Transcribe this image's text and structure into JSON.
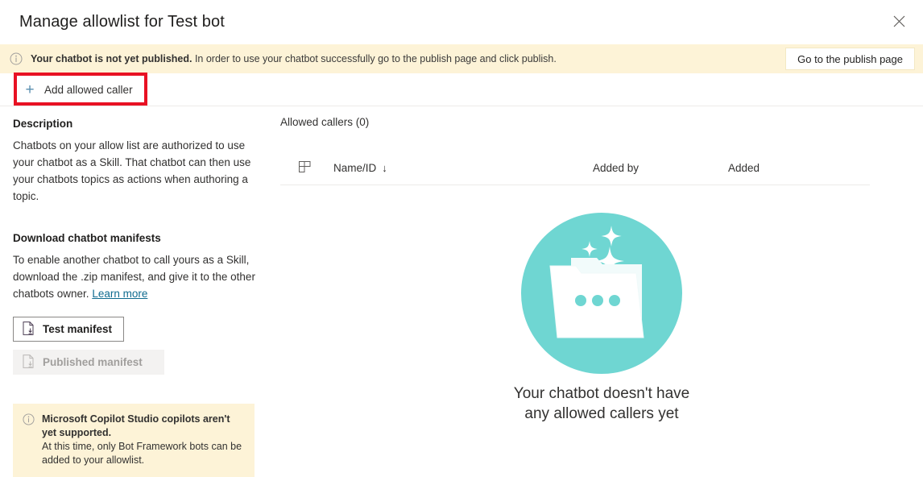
{
  "dialog": {
    "title": "Manage allowlist for Test bot",
    "close_icon": "close-icon"
  },
  "banner": {
    "info_icon": "info-circle-icon",
    "bold_text": "Your chatbot is not yet published.",
    "rest_text": " In order to use your chatbot successfully go to the publish page and click publish.",
    "action_label": "Go to the publish page",
    "background_color": "#fdf3d7"
  },
  "commandbar": {
    "add_caller_label": "Add allowed caller",
    "add_icon": "plus-icon",
    "highlight_color": "#e81123"
  },
  "left_pane": {
    "description_heading": "Description",
    "description_text": "Chatbots on your allow list are authorized to use your chatbot as a Skill. That chatbot can then use your chatbots topics as actions when authoring a topic.",
    "download_heading": "Download chatbot manifests",
    "download_text": "To enable another chatbot to call yours as a Skill, download the .zip manifest, and give it to the other chatbots owner. ",
    "learn_more_label": "Learn more",
    "test_manifest_label": "Test manifest",
    "published_manifest_label": "Published manifest",
    "manifest_icon": "document-download-icon",
    "infobox": {
      "icon": "info-circle-icon",
      "title": "Microsoft Copilot Studio copilots aren't yet supported.",
      "body": "At this time, only Bot Framework bots can be added to your allowlist.",
      "background_color": "#fdf3d7"
    }
  },
  "right_pane": {
    "list_title": "Allowed callers (0)",
    "table": {
      "column_picker_icon": "grid-columns-icon",
      "columns": [
        {
          "label": "Name/ID",
          "sort_icon": "arrow-down-icon"
        },
        {
          "label": "Added by",
          "sort_icon": ""
        },
        {
          "label": "Added",
          "sort_icon": ""
        }
      ],
      "rows": []
    },
    "empty_state": {
      "illustration": "folder-sparkle-illustration",
      "accent_color": "#6fd6d2",
      "message_line1": "Your chatbot doesn't",
      "message_line2": "have any allowed callers",
      "message_line3": "yet"
    }
  }
}
